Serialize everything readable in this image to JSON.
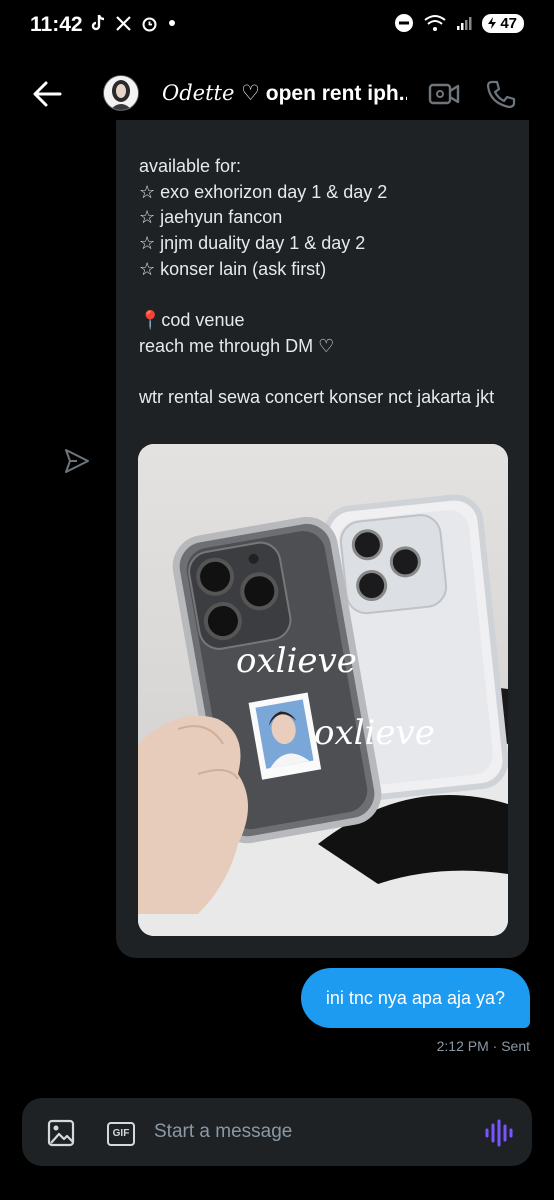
{
  "status_bar": {
    "time": "11:42",
    "battery": "47"
  },
  "header": {
    "contact_name": "Odette ♡",
    "contact_suffix": " open rent iph..."
  },
  "message_in": {
    "lines": [
      "available for:",
      "☆ exo exhorizon day 1 & day 2",
      "☆ jaehyun fancon",
      "☆ jnjm duality day 1 & day 2",
      "☆ konser lain (ask first)",
      "",
      "📍cod venue",
      "reach me through DM ♡",
      "",
      "wtr rental sewa concert konser nct jakarta jkt"
    ],
    "photo_watermark_1": "oxlieve",
    "photo_watermark_2": "oxlieve"
  },
  "message_out": {
    "text": "ini tnc nya apa aja ya?",
    "meta": "2:12 PM · Sent"
  },
  "compose": {
    "placeholder": "Start a message",
    "gif_label": "GIF"
  },
  "colors": {
    "accent": "#1d9bf0",
    "bubble_received": "#1e2224",
    "background": "#000000",
    "voice": "#7856ff"
  }
}
